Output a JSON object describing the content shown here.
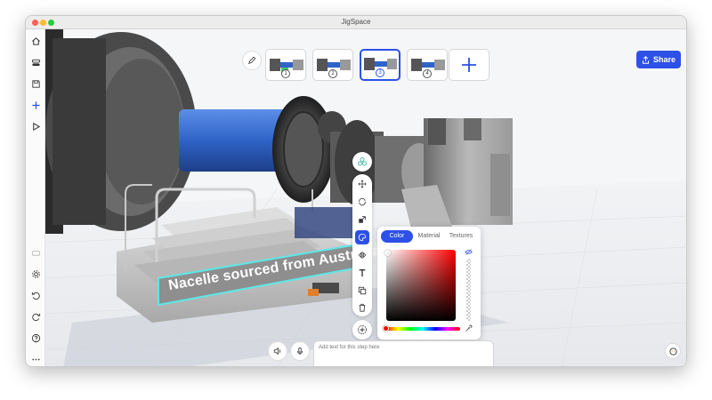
{
  "window": {
    "title": "JigSpace"
  },
  "header": {
    "share_label": "Share"
  },
  "steps": [
    {
      "number": "1"
    },
    {
      "number": "2"
    },
    {
      "number": "3"
    },
    {
      "number": "4"
    }
  ],
  "scene": {
    "label_text": "Nacelle sourced from Australian cast"
  },
  "color_panel": {
    "tabs": [
      "Color",
      "Material",
      "Textures"
    ],
    "active_tab": "Color"
  },
  "step_text": {
    "placeholder": "Add text for this step here"
  },
  "colors": {
    "accent": "#2d50e6",
    "highlight": "#5de8e6",
    "shaft_blue": "#2f63c7"
  }
}
